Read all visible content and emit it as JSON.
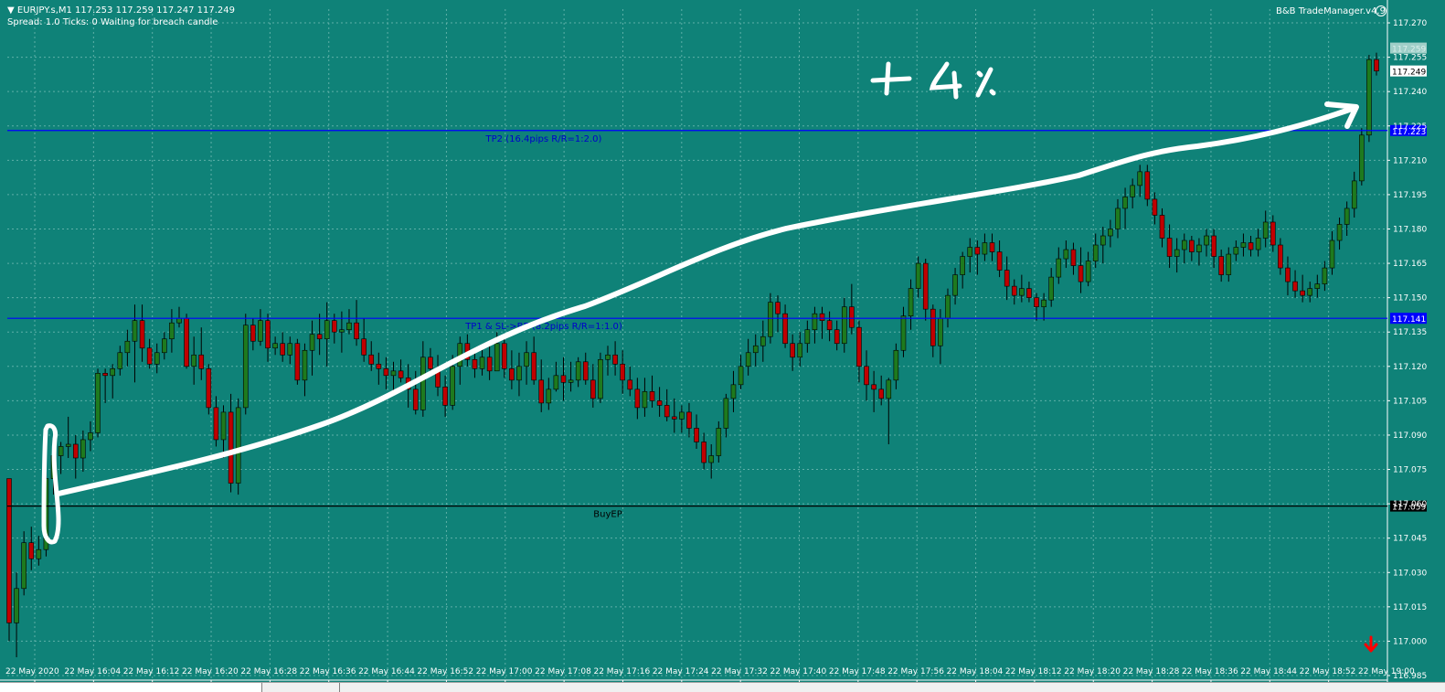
{
  "header": {
    "symbol_line": "EURJPY.s,M1  117.253 117.259 117.247 117.249",
    "status_line": "Spread: 1.0  Ticks: 0  Waiting for breach candle",
    "trade_manager": "B&B TradeManager.v4.9"
  },
  "annotation": {
    "text": "+ 4 %"
  },
  "price_axis": {
    "ticks": [
      "117.270",
      "117.255",
      "117.240",
      "117.225",
      "117.210",
      "117.195",
      "117.180",
      "117.165",
      "117.150",
      "117.135",
      "117.120",
      "117.105",
      "117.090",
      "117.075",
      "117.060",
      "117.045",
      "117.030",
      "117.015",
      "117.000",
      "116.985"
    ],
    "current_price": "117.249",
    "bid_label": "117.259"
  },
  "time_axis": {
    "labels": [
      "22 May 2020",
      "22 May 16:04",
      "22 May 16:12",
      "22 May 16:20",
      "22 May 16:28",
      "22 May 16:36",
      "22 May 16:44",
      "22 May 16:52",
      "22 May 17:00",
      "22 May 17:08",
      "22 May 17:16",
      "22 May 17:24",
      "22 May 17:32",
      "22 May 17:40",
      "22 May 17:48",
      "22 May 17:56",
      "22 May 18:04",
      "22 May 18:12",
      "22 May 18:20",
      "22 May 18:28",
      "22 May 18:36",
      "22 May 18:44",
      "22 May 18:52",
      "22 May 19:00"
    ]
  },
  "levels": [
    {
      "name": "tp2",
      "price": 117.223,
      "price_label": "117.223",
      "text": "TP2 (16.4pips R/R=1:2.0)",
      "color": "#0000ff",
      "label_color": "#0000cc"
    },
    {
      "name": "tp1",
      "price": 117.141,
      "price_label": "117.141",
      "text": "TP1 & SL->BE (8.2pips R/R=1:1.0)",
      "color": "#0000ff",
      "label_color": "#0000cc"
    },
    {
      "name": "entry",
      "price": 117.059,
      "price_label": "117.059",
      "text": "BuyEP",
      "color": "#000000",
      "label_color": "#000000"
    }
  ],
  "colors": {
    "background": "#0f8278",
    "bull_candle": "#1e7a1e",
    "bear_candle": "#c00000",
    "grid": "#5fb0a8",
    "arrow_down": "#ff0000"
  },
  "chart_data": {
    "type": "candlestick",
    "symbol": "EURJPY.s",
    "timeframe": "M1",
    "ylim": [
      116.983,
      117.276
    ],
    "candles": [
      [
        117.071,
        117.071,
        117.0,
        117.008
      ],
      [
        117.008,
        117.03,
        116.993,
        117.023
      ],
      [
        117.023,
        117.048,
        117.02,
        117.043
      ],
      [
        117.043,
        117.05,
        117.031,
        117.036
      ],
      [
        117.036,
        117.046,
        117.033,
        117.04
      ],
      [
        117.04,
        117.074,
        117.037,
        117.071
      ],
      [
        117.071,
        117.088,
        117.064,
        117.081
      ],
      [
        117.081,
        117.087,
        117.073,
        117.085
      ],
      [
        117.085,
        117.098,
        117.08,
        117.086
      ],
      [
        117.086,
        117.09,
        117.071,
        117.08
      ],
      [
        117.08,
        117.092,
        117.074,
        117.088
      ],
      [
        117.088,
        117.096,
        117.083,
        117.091
      ],
      [
        117.091,
        117.119,
        117.089,
        117.117
      ],
      [
        117.117,
        117.119,
        117.104,
        117.116
      ],
      [
        117.116,
        117.121,
        117.106,
        117.119
      ],
      [
        117.119,
        117.129,
        117.116,
        117.126
      ],
      [
        117.126,
        117.136,
        117.12,
        117.131
      ],
      [
        117.131,
        117.147,
        117.113,
        117.14
      ],
      [
        117.14,
        117.147,
        117.122,
        117.128
      ],
      [
        117.128,
        117.132,
        117.119,
        117.121
      ],
      [
        117.121,
        117.13,
        117.117,
        117.126
      ],
      [
        117.126,
        117.135,
        117.123,
        117.132
      ],
      [
        117.132,
        117.145,
        117.126,
        117.139
      ],
      [
        117.139,
        117.146,
        117.137,
        117.141
      ],
      [
        117.141,
        117.143,
        117.119,
        117.12
      ],
      [
        117.12,
        117.133,
        117.112,
        117.125
      ],
      [
        117.125,
        117.137,
        117.114,
        117.119
      ],
      [
        117.119,
        117.121,
        117.099,
        117.102
      ],
      [
        117.102,
        117.107,
        117.085,
        117.088
      ],
      [
        117.088,
        117.103,
        117.08,
        117.1
      ],
      [
        117.1,
        117.108,
        117.065,
        117.069
      ],
      [
        117.069,
        117.106,
        117.064,
        117.102
      ],
      [
        117.102,
        117.143,
        117.099,
        117.138
      ],
      [
        117.138,
        117.141,
        117.127,
        117.131
      ],
      [
        117.131,
        117.145,
        117.129,
        117.14
      ],
      [
        117.14,
        117.143,
        117.122,
        117.128
      ],
      [
        117.128,
        117.133,
        117.125,
        117.13
      ],
      [
        117.13,
        117.135,
        117.122,
        117.125
      ],
      [
        117.125,
        117.133,
        117.121,
        117.13
      ],
      [
        117.13,
        117.132,
        117.112,
        117.114
      ],
      [
        117.114,
        117.13,
        117.107,
        117.127
      ],
      [
        117.127,
        117.14,
        117.116,
        117.134
      ],
      [
        117.134,
        117.143,
        117.125,
        117.132
      ],
      [
        117.132,
        117.148,
        117.12,
        117.14
      ],
      [
        117.14,
        117.143,
        117.13,
        117.135
      ],
      [
        117.135,
        117.144,
        117.126,
        117.136
      ],
      [
        117.136,
        117.145,
        117.134,
        117.139
      ],
      [
        117.139,
        117.149,
        117.129,
        117.132
      ],
      [
        117.132,
        117.141,
        117.122,
        117.125
      ],
      [
        117.125,
        117.131,
        117.118,
        117.121
      ],
      [
        117.121,
        117.126,
        117.112,
        117.119
      ],
      [
        117.119,
        117.124,
        117.11,
        117.116
      ],
      [
        117.116,
        117.122,
        117.109,
        117.118
      ],
      [
        117.118,
        117.123,
        117.113,
        117.115
      ],
      [
        117.115,
        117.121,
        117.102,
        117.11
      ],
      [
        117.11,
        117.118,
        117.099,
        117.101
      ],
      [
        117.101,
        117.131,
        117.098,
        117.124
      ],
      [
        117.124,
        117.128,
        117.116,
        117.119
      ],
      [
        117.119,
        117.125,
        117.107,
        117.111
      ],
      [
        117.111,
        117.116,
        117.098,
        117.103
      ],
      [
        117.103,
        117.125,
        117.101,
        117.12
      ],
      [
        117.12,
        117.133,
        117.112,
        117.13
      ],
      [
        117.13,
        117.134,
        117.12,
        117.123
      ],
      [
        117.123,
        117.128,
        117.115,
        117.119
      ],
      [
        117.119,
        117.128,
        117.116,
        117.124
      ],
      [
        117.124,
        117.13,
        117.114,
        117.118
      ],
      [
        117.118,
        117.135,
        117.118,
        117.13
      ],
      [
        117.13,
        117.133,
        117.115,
        117.119
      ],
      [
        117.119,
        117.127,
        117.11,
        117.114
      ],
      [
        117.114,
        117.126,
        117.107,
        117.12
      ],
      [
        117.12,
        117.131,
        117.112,
        117.126
      ],
      [
        117.126,
        117.133,
        117.112,
        117.114
      ],
      [
        117.114,
        117.123,
        117.1,
        117.104
      ],
      [
        117.104,
        117.115,
        117.101,
        117.11
      ],
      [
        117.11,
        117.122,
        117.109,
        117.116
      ],
      [
        117.116,
        117.124,
        117.105,
        117.113
      ],
      [
        117.113,
        117.122,
        117.109,
        117.114
      ],
      [
        117.114,
        117.124,
        117.111,
        117.122
      ],
      [
        117.122,
        117.126,
        117.112,
        117.114
      ],
      [
        117.114,
        117.121,
        117.102,
        117.106
      ],
      [
        117.106,
        117.126,
        117.104,
        117.123
      ],
      [
        117.123,
        117.129,
        117.116,
        117.125
      ],
      [
        117.125,
        117.131,
        117.116,
        117.121
      ],
      [
        117.121,
        117.127,
        117.108,
        117.114
      ],
      [
        117.114,
        117.12,
        117.107,
        117.11
      ],
      [
        117.11,
        117.115,
        117.097,
        117.102
      ],
      [
        117.102,
        117.115,
        117.098,
        117.109
      ],
      [
        117.109,
        117.116,
        117.102,
        117.105
      ],
      [
        117.105,
        117.111,
        117.098,
        117.103
      ],
      [
        117.103,
        117.11,
        117.096,
        117.098
      ],
      [
        117.098,
        117.106,
        117.091,
        117.097
      ],
      [
        117.097,
        117.103,
        117.091,
        117.1
      ],
      [
        117.1,
        117.104,
        117.089,
        117.093
      ],
      [
        117.093,
        117.099,
        117.084,
        117.087
      ],
      [
        117.087,
        117.091,
        117.075,
        117.078
      ],
      [
        117.078,
        117.086,
        117.071,
        117.081
      ],
      [
        117.081,
        117.096,
        117.078,
        117.093
      ],
      [
        117.093,
        117.108,
        117.089,
        117.106
      ],
      [
        117.106,
        117.118,
        117.1,
        117.112
      ],
      [
        117.112,
        117.125,
        117.11,
        117.12
      ],
      [
        117.12,
        117.132,
        117.116,
        117.126
      ],
      [
        117.126,
        117.134,
        117.12,
        117.129
      ],
      [
        117.129,
        117.14,
        117.122,
        117.133
      ],
      [
        117.133,
        117.152,
        117.13,
        117.148
      ],
      [
        117.148,
        117.151,
        117.135,
        117.143
      ],
      [
        117.143,
        117.147,
        117.128,
        117.13
      ],
      [
        117.13,
        117.134,
        117.118,
        117.124
      ],
      [
        117.124,
        117.135,
        117.12,
        117.13
      ],
      [
        117.13,
        117.14,
        117.126,
        117.136
      ],
      [
        117.136,
        117.146,
        117.13,
        117.143
      ],
      [
        117.143,
        117.146,
        117.132,
        117.14
      ],
      [
        117.14,
        117.144,
        117.131,
        117.136
      ],
      [
        117.136,
        117.14,
        117.127,
        117.13
      ],
      [
        117.13,
        117.15,
        117.126,
        117.146
      ],
      [
        117.146,
        117.156,
        117.134,
        117.137
      ],
      [
        117.137,
        117.14,
        117.113,
        117.12
      ],
      [
        117.12,
        117.127,
        117.105,
        117.112
      ],
      [
        117.112,
        117.118,
        117.1,
        117.11
      ],
      [
        117.11,
        117.116,
        117.103,
        117.106
      ],
      [
        117.106,
        117.115,
        117.086,
        117.114
      ],
      [
        117.114,
        117.13,
        117.11,
        117.127
      ],
      [
        117.127,
        117.146,
        117.124,
        117.142
      ],
      [
        117.142,
        117.158,
        117.136,
        117.154
      ],
      [
        117.154,
        117.168,
        117.15,
        117.165
      ],
      [
        117.165,
        117.167,
        117.14,
        117.145
      ],
      [
        117.145,
        117.147,
        117.124,
        117.129
      ],
      [
        117.129,
        117.145,
        117.121,
        117.141
      ],
      [
        117.141,
        117.154,
        117.137,
        117.151
      ],
      [
        117.151,
        117.163,
        117.147,
        117.16
      ],
      [
        117.16,
        117.17,
        117.154,
        117.168
      ],
      [
        117.168,
        117.176,
        117.161,
        117.172
      ],
      [
        117.172,
        117.175,
        117.16,
        117.169
      ],
      [
        117.169,
        117.178,
        117.166,
        117.174
      ],
      [
        117.174,
        117.178,
        117.166,
        117.17
      ],
      [
        117.17,
        117.175,
        117.159,
        117.162
      ],
      [
        117.162,
        117.168,
        117.149,
        117.155
      ],
      [
        117.155,
        117.158,
        117.147,
        117.151
      ],
      [
        117.151,
        117.16,
        117.148,
        117.154
      ],
      [
        117.154,
        117.157,
        117.148,
        117.15
      ],
      [
        117.15,
        117.152,
        117.14,
        117.146
      ],
      [
        117.146,
        117.152,
        117.14,
        117.149
      ],
      [
        117.149,
        117.163,
        117.146,
        117.159
      ],
      [
        117.159,
        117.172,
        117.156,
        117.167
      ],
      [
        117.167,
        117.175,
        117.163,
        117.171
      ],
      [
        117.171,
        117.174,
        117.16,
        117.164
      ],
      [
        117.164,
        117.172,
        117.152,
        117.157
      ],
      [
        117.157,
        117.17,
        117.155,
        117.166
      ],
      [
        117.166,
        117.178,
        117.163,
        117.173
      ],
      [
        117.173,
        117.181,
        117.165,
        117.177
      ],
      [
        117.177,
        117.184,
        117.172,
        117.18
      ],
      [
        117.18,
        117.193,
        117.176,
        117.189
      ],
      [
        117.189,
        117.198,
        117.18,
        117.194
      ],
      [
        117.194,
        117.202,
        117.189,
        117.199
      ],
      [
        117.199,
        117.208,
        117.194,
        117.205
      ],
      [
        117.205,
        117.208,
        117.19,
        117.193
      ],
      [
        117.193,
        117.196,
        117.182,
        117.186
      ],
      [
        117.186,
        117.189,
        117.172,
        117.176
      ],
      [
        117.176,
        117.182,
        117.163,
        117.168
      ],
      [
        117.168,
        117.176,
        117.161,
        117.171
      ],
      [
        117.171,
        117.178,
        117.165,
        117.175
      ],
      [
        117.175,
        117.177,
        117.166,
        117.17
      ],
      [
        117.17,
        117.176,
        117.164,
        117.173
      ],
      [
        117.173,
        117.18,
        117.168,
        117.177
      ],
      [
        117.177,
        117.18,
        117.163,
        117.168
      ],
      [
        117.168,
        117.171,
        117.157,
        117.16
      ],
      [
        117.16,
        117.172,
        117.157,
        117.169
      ],
      [
        117.169,
        117.175,
        117.166,
        117.172
      ],
      [
        117.172,
        117.178,
        117.168,
        117.174
      ],
      [
        117.174,
        117.177,
        117.168,
        117.171
      ],
      [
        117.171,
        117.18,
        117.168,
        117.176
      ],
      [
        117.176,
        117.188,
        117.172,
        117.183
      ],
      [
        117.183,
        117.186,
        117.17,
        117.173
      ],
      [
        117.173,
        117.176,
        117.16,
        117.163
      ],
      [
        117.163,
        117.168,
        117.151,
        117.157
      ],
      [
        117.157,
        117.162,
        117.15,
        117.153
      ],
      [
        117.153,
        117.16,
        117.148,
        117.151
      ],
      [
        117.151,
        117.157,
        117.148,
        117.154
      ],
      [
        117.154,
        117.16,
        117.15,
        117.156
      ],
      [
        117.156,
        117.166,
        117.153,
        117.163
      ],
      [
        117.163,
        117.179,
        117.16,
        117.175
      ],
      [
        117.175,
        117.185,
        117.171,
        117.182
      ],
      [
        117.182,
        117.192,
        117.177,
        117.189
      ],
      [
        117.189,
        117.205,
        117.185,
        117.201
      ],
      [
        117.201,
        117.224,
        117.199,
        117.221
      ],
      [
        117.221,
        117.256,
        117.218,
        117.254
      ],
      [
        117.254,
        117.257,
        117.247,
        117.249
      ]
    ]
  }
}
